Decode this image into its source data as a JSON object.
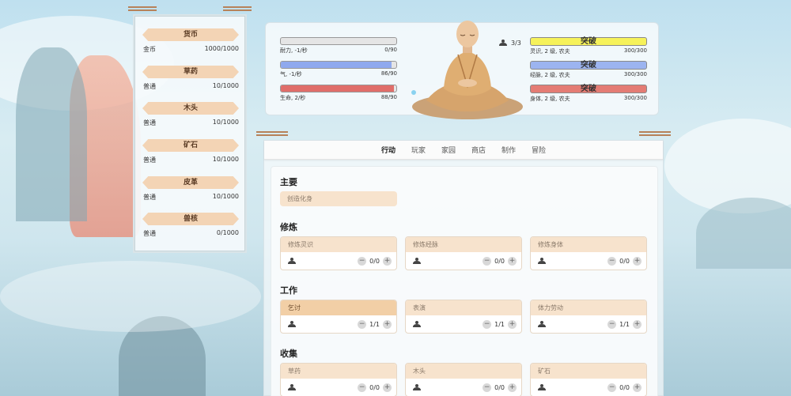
{
  "resources": [
    {
      "title": "货币",
      "name": "金币",
      "value": "1000/1000"
    },
    {
      "title": "草药",
      "name": "普通",
      "value": "10/1000"
    },
    {
      "title": "木头",
      "name": "普通",
      "value": "10/1000"
    },
    {
      "title": "矿石",
      "name": "普通",
      "value": "10/1000"
    },
    {
      "title": "皮革",
      "name": "普通",
      "value": "10/1000"
    },
    {
      "title": "兽核",
      "name": "普通",
      "value": "0/1000"
    }
  ],
  "status": {
    "bars": [
      {
        "label": "耐力, -1/秒",
        "value": "0/90",
        "fraction": 0.0,
        "color": "#c9c9c9"
      },
      {
        "label": "气, -1/秒",
        "value": "86/90",
        "fraction": 0.956,
        "color": "#8fa9ee"
      },
      {
        "label": "生命, 2/秒",
        "value": "88/90",
        "fraction": 0.978,
        "color": "#e06e6a"
      }
    ],
    "workers": "3/3",
    "breakthroughs": [
      {
        "button": "突破",
        "label": "灵识, 2 级, 农夫",
        "value": "300/300",
        "color": "#f6f25a"
      },
      {
        "button": "突破",
        "label": "经脉, 2 级, 农夫",
        "value": "300/300",
        "color": "#9cb4f0"
      },
      {
        "button": "突破",
        "label": "身体, 2 级, 农夫",
        "value": "300/300",
        "color": "#e47c74"
      }
    ]
  },
  "tabs": [
    "行动",
    "玩家",
    "家园",
    "商店",
    "制作",
    "冒险"
  ],
  "sections": {
    "main": {
      "title": "主要",
      "items": [
        "创造化身"
      ]
    },
    "cultivate": {
      "title": "修炼",
      "items": [
        {
          "name": "修炼灵识",
          "count": "0/0"
        },
        {
          "name": "修炼经脉",
          "count": "0/0"
        },
        {
          "name": "修炼身体",
          "count": "0/0"
        }
      ]
    },
    "work": {
      "title": "工作",
      "items": [
        {
          "name": "乞讨",
          "count": "1/1"
        },
        {
          "name": "表演",
          "count": "1/1"
        },
        {
          "name": "体力劳动",
          "count": "1/1"
        }
      ]
    },
    "gather": {
      "title": "收集",
      "items": [
        {
          "name": "草药",
          "count": "0/0"
        },
        {
          "name": "木头",
          "count": "0/0"
        },
        {
          "name": "矿石",
          "count": "0/0"
        }
      ]
    }
  },
  "stepper": {
    "minus": "−",
    "plus": "+"
  }
}
